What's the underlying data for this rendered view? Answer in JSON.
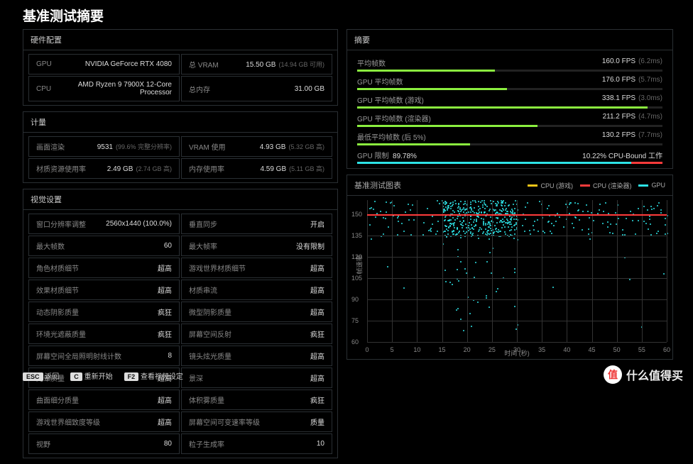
{
  "title": "基准测试摘要",
  "hardware": {
    "heading": "硬件配置",
    "rows": [
      {
        "k1": "GPU",
        "v1": "NVIDIA GeForce RTX 4080",
        "k2": "总 VRAM",
        "v2": "15.50 GB",
        "s2": "(14.94 GB 可用)"
      },
      {
        "k1": "CPU",
        "v1": "AMD Ryzen 9 7900X 12-Core Processor",
        "k2": "总内存",
        "v2": "31.00 GB",
        "s2": ""
      }
    ]
  },
  "metrics": {
    "heading": "计量",
    "rows": [
      {
        "k1": "画面渲染",
        "v1": "9531",
        "s1": "(99.6% 完整分辨率)",
        "k2": "VRAM 使用",
        "v2": "4.93 GB",
        "s2": "(5.32 GB 高)"
      },
      {
        "k1": "材质资源使用率",
        "v1": "2.49 GB",
        "s1": "(2.74 GB 高)",
        "k2": "内存使用率",
        "v2": "4.59 GB",
        "s2": "(5.11 GB 高)"
      }
    ]
  },
  "visual": {
    "heading": "视觉设置",
    "rows": [
      {
        "k1": "窗口分辨率调整",
        "v1": "2560x1440 (100.0%)",
        "k2": "垂直同步",
        "v2": "开启"
      },
      {
        "k1": "最大帧数",
        "v1": "60",
        "k2": "最大帧率",
        "v2": "没有限制"
      },
      {
        "k1": "角色材质细节",
        "v1": "超高",
        "k2": "游戏世界材质细节",
        "v2": "超高"
      },
      {
        "k1": "效果材质细节",
        "v1": "超高",
        "k2": "材质串流",
        "v2": "超高"
      },
      {
        "k1": "动态阴影质量",
        "v1": "疯狂",
        "k2": "微型阴影质量",
        "v2": "超高"
      },
      {
        "k1": "环境光遮蔽质量",
        "v1": "疯狂",
        "k2": "屏幕空间反射",
        "v2": "疯狂"
      },
      {
        "k1": "屏幕空间全局照明射线计数",
        "v1": "8",
        "k2": "镜头炫光质量",
        "v2": "超高"
      },
      {
        "k1": "光晕质量",
        "v1": "超高",
        "k2": "景深",
        "v2": "超高"
      },
      {
        "k1": "曲面细分质量",
        "v1": "超高",
        "k2": "体积雾质量",
        "v2": "疯狂"
      },
      {
        "k1": "游戏世界细致度等级",
        "v1": "超高",
        "k2": "屏幕空间可变速率等级",
        "v2": "质量"
      },
      {
        "k1": "视野",
        "v1": "80",
        "k2": "粒子生成率",
        "v2": "10"
      }
    ]
  },
  "summary": {
    "heading": "摘要",
    "items": [
      {
        "label": "平均帧数",
        "value": "160.0 FPS",
        "sub": "(6.2ms)",
        "pct": 45
      },
      {
        "label": "GPU 平均帧数",
        "value": "176.0 FPS",
        "sub": "(5.7ms)",
        "pct": 49
      },
      {
        "label": "GPU 平均帧数 (游戏)",
        "value": "338.1 FPS",
        "sub": "(3.0ms)",
        "pct": 95
      },
      {
        "label": "GPU 平均帧数 (渲染器)",
        "value": "211.2 FPS",
        "sub": "(4.7ms)",
        "pct": 59
      },
      {
        "label": "最低平均帧数 (后 5%)",
        "value": "130.2 FPS",
        "sub": "(7.7ms)",
        "pct": 37
      }
    ],
    "limit": {
      "label": "GPU 限制",
      "pct_label": "89.78%",
      "right": "10.22% CPU-Bound 工作",
      "pct": 89.78
    }
  },
  "chart": {
    "heading": "基准测试图表",
    "legend": {
      "a": "CPU (游戏)",
      "b": "CPU (渲染器)",
      "c": "GPU"
    },
    "ylabel": "帧速率",
    "xlabel": "时间 (秒)"
  },
  "chart_data": {
    "type": "scatter",
    "title": "基准测试图表",
    "xlabel": "时间 (秒)",
    "ylabel": "帧速率",
    "xlim": [
      0,
      60
    ],
    "ylim": [
      60,
      160
    ],
    "yticks": [
      60,
      75,
      90,
      105,
      120,
      135,
      150
    ],
    "xticks": [
      0,
      5,
      10,
      15,
      20,
      25,
      30,
      35,
      40,
      45,
      50,
      55,
      60
    ],
    "redline_y": 150,
    "series": [
      {
        "name": "GPU",
        "color": "#2de2e6"
      },
      {
        "name": "CPU (游戏)",
        "color": "#f5c518"
      },
      {
        "name": "CPU (渲染器)",
        "color": "#ff3b3b"
      }
    ],
    "note": "Dense scatter cloud of GPU points mostly between y=135 and y=160, concentrated around x=15-30; sparse points spread across full x range."
  },
  "footer": {
    "esc_key": "ESC",
    "esc_label": "返回",
    "c_key": "C",
    "c_label": "重新开始",
    "f2_key": "F2",
    "f2_label": "查看视频设定"
  },
  "watermark": {
    "icon": "值",
    "text": "什么值得买"
  }
}
